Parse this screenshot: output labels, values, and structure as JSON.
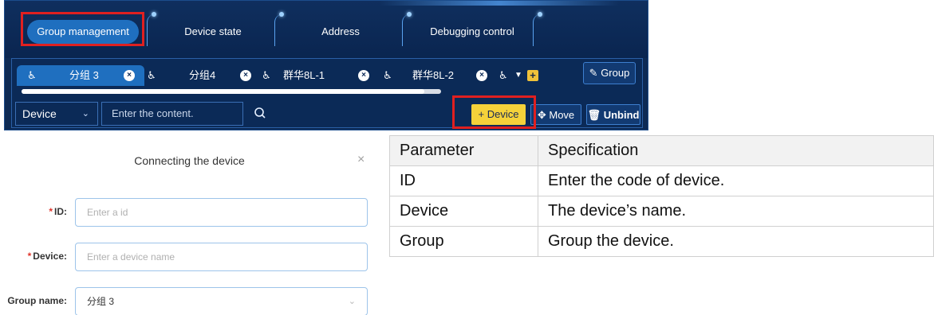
{
  "top_tabs": [
    {
      "label": "Group management",
      "active": true
    },
    {
      "label": "Device state",
      "active": false
    },
    {
      "label": "Address",
      "active": false
    },
    {
      "label": "Debugging control",
      "active": false
    }
  ],
  "group_tabs": [
    {
      "label": "分组 3",
      "active": true
    },
    {
      "label": "分组4",
      "active": false
    },
    {
      "label": "群华8L-1",
      "active": false
    },
    {
      "label": "群华8L-2",
      "active": false
    }
  ],
  "group_button_label": "Group",
  "scroll_progress": 0.96,
  "toolbar": {
    "select_value": "Device",
    "search_placeholder": "Enter the content.",
    "device_button": "+ Device",
    "move_button": "Move",
    "unbind_button": "Unbind"
  },
  "dialog": {
    "title": "Connecting the device",
    "close_symbol": "×",
    "fields": [
      {
        "label": "ID:",
        "required": true,
        "placeholder": "Enter a id"
      },
      {
        "label": "Device:",
        "required": true,
        "placeholder": "Enter a device name"
      },
      {
        "label": "Group name:",
        "required": false,
        "value": "分组 3"
      }
    ]
  },
  "spec_table": {
    "headers": [
      "Parameter",
      "Specification"
    ],
    "rows": [
      [
        "ID",
        "Enter the code of device."
      ],
      [
        "Device",
        "The device’s name."
      ],
      [
        "Group",
        "Group the device."
      ]
    ]
  },
  "colors": {
    "panel_bg": "#0d2a54",
    "active_blue": "#1f6fbf",
    "highlight_red": "#e02020",
    "device_yellow": "#f5d23a"
  }
}
